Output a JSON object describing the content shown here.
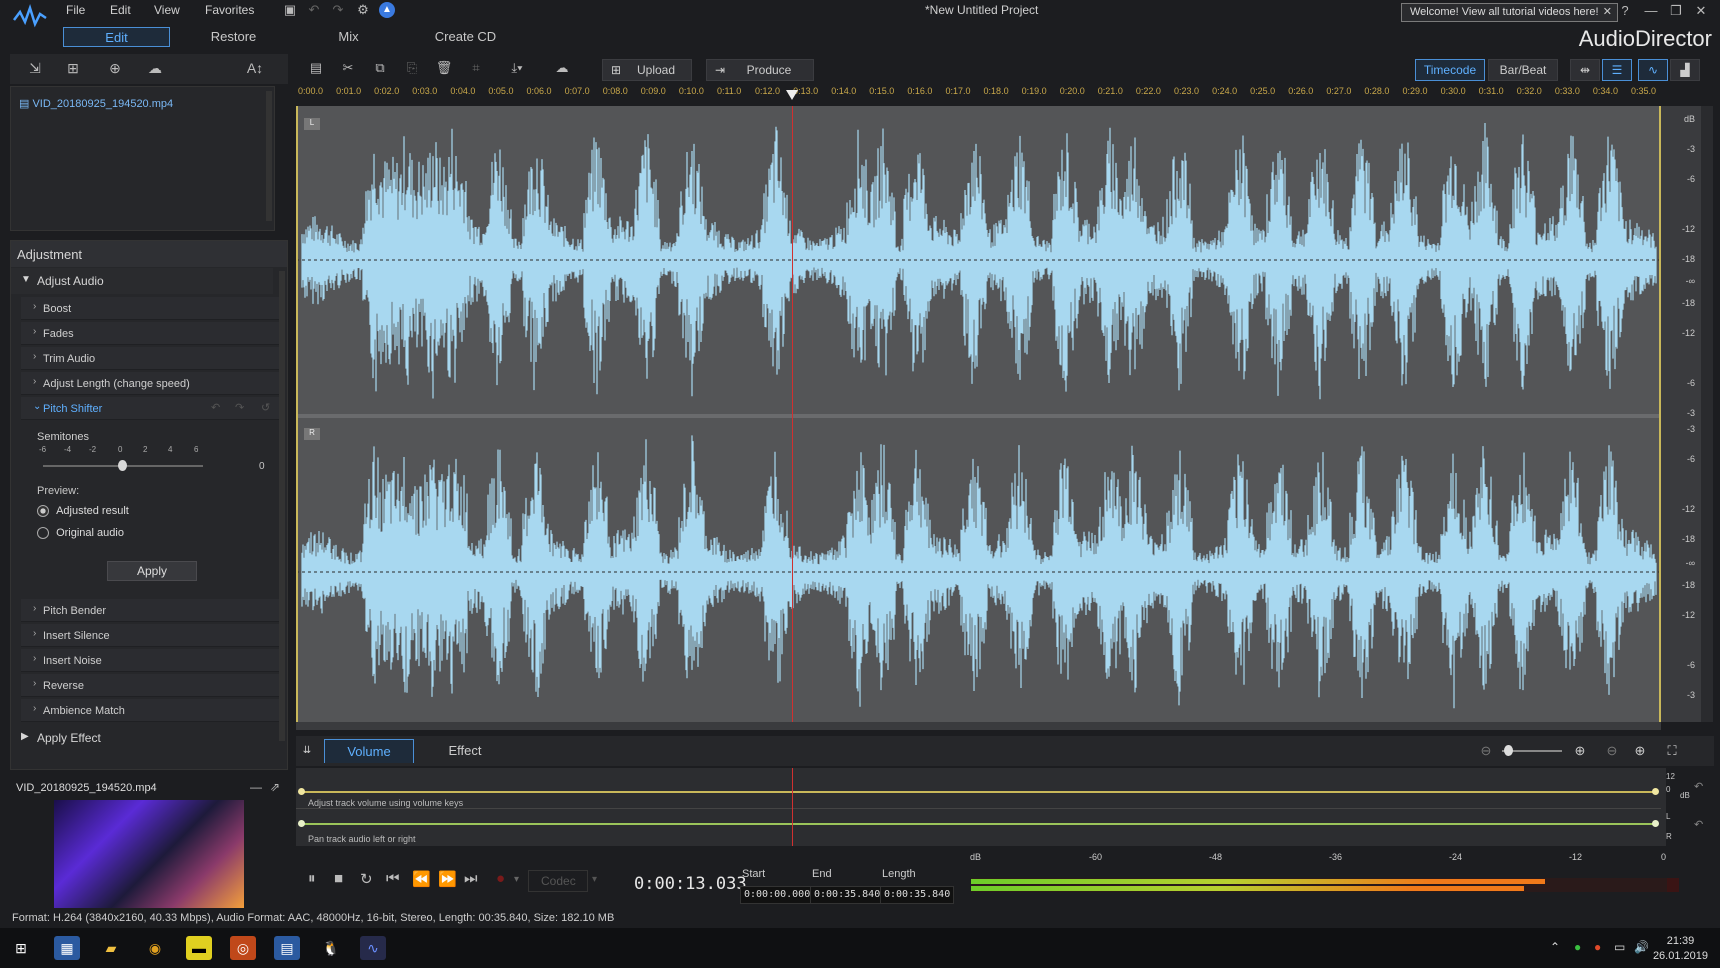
{
  "app": {
    "name": "AudioDirector",
    "project_title": "*New Untitled Project"
  },
  "menu": [
    "File",
    "Edit",
    "View",
    "Favorites"
  ],
  "welcome_banner": "Welcome! View all tutorial videos here!",
  "mode_tabs": [
    {
      "label": "Edit",
      "active": true
    },
    {
      "label": "Restore",
      "active": false
    },
    {
      "label": "Mix",
      "active": false
    },
    {
      "label": "Create CD",
      "active": false
    }
  ],
  "library": {
    "files": [
      "VID_20180925_194520.mp4"
    ]
  },
  "adjustment": {
    "title": "Adjustment",
    "group": "Adjust Audio",
    "items": [
      "Boost",
      "Fades",
      "Trim Audio",
      "Adjust Length (change speed)",
      "Pitch Shifter"
    ],
    "pitch_shifter": {
      "semitones_label": "Semitones",
      "scale": [
        "-6",
        "-4",
        "-2",
        "0",
        "2",
        "4",
        "6"
      ],
      "value": "0",
      "preview_label": "Preview:",
      "options": [
        "Adjusted result",
        "Original audio"
      ],
      "selected": "Adjusted result",
      "apply_label": "Apply"
    },
    "items_after": [
      "Pitch Bender",
      "Insert Silence",
      "Insert Noise",
      "Reverse",
      "Ambience Match"
    ],
    "apply_effect": "Apply Effect"
  },
  "preview": {
    "filename": "VID_20180925_194520.mp4"
  },
  "toolbar": {
    "upload": "Upload",
    "produce": "Produce",
    "timecode": "Timecode",
    "barbeat": "Bar/Beat"
  },
  "ruler": [
    "0:00.0",
    "0:01.0",
    "0:02.0",
    "0:03.0",
    "0:04.0",
    "0:05.0",
    "0:06.0",
    "0:07.0",
    "0:08.0",
    "0:09.0",
    "0:10.0",
    "0:11.0",
    "0:12.0",
    "0:13.0",
    "0:14.0",
    "0:15.0",
    "0:16.0",
    "0:17.0",
    "0:18.0",
    "0:19.0",
    "0:20.0",
    "0:21.0",
    "0:22.0",
    "0:23.0",
    "0:24.0",
    "0:25.0",
    "0:26.0",
    "0:27.0",
    "0:28.0",
    "0:29.0",
    "0:30.0",
    "0:31.0",
    "0:32.0",
    "0:33.0",
    "0:34.0",
    "0:35.0"
  ],
  "channels": {
    "left": "L",
    "right": "R"
  },
  "db_scale_left": [
    "dB",
    "-3",
    "-6",
    "-12",
    "-18",
    "-∞",
    "-18",
    "-12",
    "-6",
    "-3"
  ],
  "db_scale_right": [
    "-3",
    "-6",
    "-12",
    "-18",
    "-∞",
    "-18",
    "-12",
    "-6",
    "-3"
  ],
  "bottom_tabs": [
    {
      "label": "Volume",
      "active": true
    },
    {
      "label": "Effect",
      "active": false
    }
  ],
  "envelope": {
    "volume_hint": "Adjust track volume using volume keys",
    "pan_hint": "Pan track audio left or right",
    "vol_scale": [
      "12",
      "0",
      "dB"
    ],
    "pan_scale": [
      "L",
      "R"
    ]
  },
  "transport": {
    "codec": "Codec",
    "current_time": "0:00:13.033",
    "start_label": "Start",
    "start_value": "0:00:00.000",
    "end_label": "End",
    "end_value": "0:00:35.840",
    "length_label": "Length",
    "length_value": "0:00:35.840"
  },
  "meter": {
    "scale": [
      "dB",
      "-60",
      "-48",
      "-36",
      "-24",
      "-12",
      "0"
    ],
    "level_top": 0.82,
    "level_bottom": 0.79
  },
  "status": "Format: H.264 (3840x2160, 40.33 Mbps), Audio Format: AAC, 48000Hz, 16-bit, Stereo, Length: 00:35.840, Size: 182.10 MB",
  "taskbar": {
    "time": "21:39",
    "date": "26.01.2019"
  },
  "playhead_time_sec": 13.033,
  "duration_sec": 35.84,
  "colors": {
    "accent": "#4a8fd6",
    "waveform": "#a8d8f0",
    "playhead": "#d03030",
    "ruler_text": "#c9a84a",
    "meter_green": "#6dcc2a",
    "meter_orange": "#f07a1a"
  }
}
